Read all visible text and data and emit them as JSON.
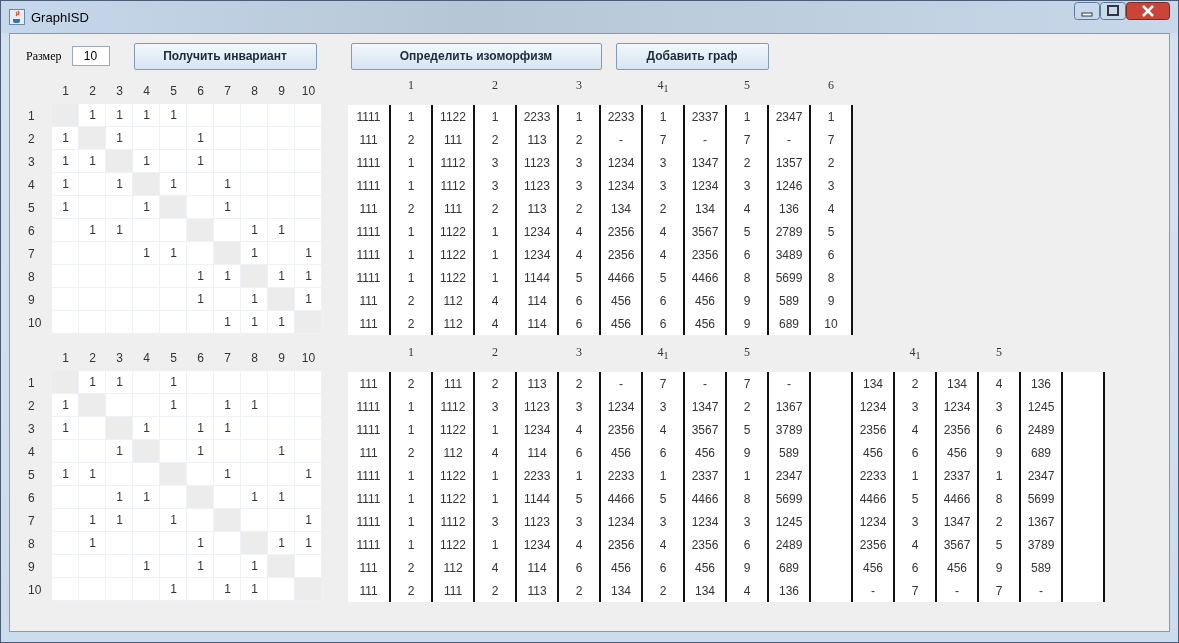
{
  "window": {
    "title": "GraphISD"
  },
  "toolbar": {
    "size_label": "Размер",
    "size_value": "10",
    "buttons": [
      "Получить инвариант",
      "Определить изоморфизм",
      "Добавить граф"
    ]
  },
  "graphs": [
    {
      "matrix": {
        "columns": [
          "1",
          "2",
          "3",
          "4",
          "5",
          "6",
          "7",
          "8",
          "9",
          "10"
        ],
        "rows": [
          {
            "label": "1",
            "cells": [
              null,
              "1",
              "1",
              "1",
              "1",
              null,
              null,
              null,
              null,
              null
            ]
          },
          {
            "label": "2",
            "cells": [
              "1",
              null,
              "1",
              null,
              null,
              "1",
              null,
              null,
              null,
              null
            ]
          },
          {
            "label": "3",
            "cells": [
              "1",
              "1",
              null,
              "1",
              null,
              "1",
              null,
              null,
              null,
              null
            ]
          },
          {
            "label": "4",
            "cells": [
              "1",
              null,
              "1",
              null,
              "1",
              null,
              "1",
              null,
              null,
              null
            ]
          },
          {
            "label": "5",
            "cells": [
              "1",
              null,
              null,
              "1",
              null,
              null,
              "1",
              null,
              null,
              null
            ]
          },
          {
            "label": "6",
            "cells": [
              null,
              "1",
              "1",
              null,
              null,
              null,
              null,
              "1",
              "1",
              null
            ]
          },
          {
            "label": "7",
            "cells": [
              null,
              null,
              null,
              "1",
              "1",
              null,
              null,
              "1",
              null,
              "1"
            ]
          },
          {
            "label": "8",
            "cells": [
              null,
              null,
              null,
              null,
              null,
              "1",
              "1",
              null,
              "1",
              "1"
            ]
          },
          {
            "label": "9",
            "cells": [
              null,
              null,
              null,
              null,
              null,
              "1",
              null,
              "1",
              null,
              "1"
            ]
          },
          {
            "label": "10",
            "cells": [
              null,
              null,
              null,
              null,
              null,
              null,
              "1",
              "1",
              "1",
              null
            ]
          }
        ]
      },
      "invariant": {
        "headers": [
          {
            "kind": "blank"
          },
          {
            "kind": "label",
            "text": "1"
          },
          {
            "kind": "blank"
          },
          {
            "kind": "label",
            "text": "2"
          },
          {
            "kind": "blank"
          },
          {
            "kind": "label",
            "text": "3"
          },
          {
            "kind": "blank"
          },
          {
            "kind": "label",
            "text": "4$_{1}$"
          },
          {
            "kind": "blank"
          },
          {
            "kind": "label",
            "text": "5"
          },
          {
            "kind": "blank"
          },
          {
            "kind": "label",
            "text": "6"
          }
        ],
        "rows": [
          [
            "1111",
            "1",
            "1122",
            "1",
            "2233",
            "1",
            "2233",
            "1",
            "2337",
            "1",
            "2347",
            "1"
          ],
          [
            "111",
            "2",
            "111",
            "2",
            "113",
            "2",
            "-",
            "7",
            "-",
            "7",
            "-",
            "7"
          ],
          [
            "1111",
            "1",
            "1112",
            "3",
            "1123",
            "3",
            "1234",
            "3",
            "1347",
            "2",
            "1357",
            "2"
          ],
          [
            "1111",
            "1",
            "1112",
            "3",
            "1123",
            "3",
            "1234",
            "3",
            "1234",
            "3",
            "1246",
            "3"
          ],
          [
            "111",
            "2",
            "111",
            "2",
            "113",
            "2",
            "134",
            "2",
            "134",
            "4",
            "136",
            "4"
          ],
          [
            "1111",
            "1",
            "1122",
            "1",
            "1234",
            "4",
            "2356",
            "4",
            "3567",
            "5",
            "2789",
            "5"
          ],
          [
            "1111",
            "1",
            "1122",
            "1",
            "1234",
            "4",
            "2356",
            "4",
            "2356",
            "6",
            "3489",
            "6"
          ],
          [
            "1111",
            "1",
            "1122",
            "1",
            "1144",
            "5",
            "4466",
            "5",
            "4466",
            "8",
            "5699",
            "8"
          ],
          [
            "111",
            "2",
            "112",
            "4",
            "114",
            "6",
            "456",
            "6",
            "456",
            "9",
            "589",
            "9"
          ],
          [
            "111",
            "2",
            "112",
            "4",
            "114",
            "6",
            "456",
            "6",
            "456",
            "9",
            "689",
            "10"
          ]
        ]
      }
    },
    {
      "matrix": {
        "columns": [
          "1",
          "2",
          "3",
          "4",
          "5",
          "6",
          "7",
          "8",
          "9",
          "10"
        ],
        "rows": [
          {
            "label": "1",
            "cells": [
              null,
              "1",
              "1",
              null,
              "1",
              null,
              null,
              null,
              null,
              null
            ]
          },
          {
            "label": "2",
            "cells": [
              "1",
              null,
              null,
              null,
              "1",
              null,
              "1",
              "1",
              null,
              null
            ]
          },
          {
            "label": "3",
            "cells": [
              "1",
              null,
              null,
              "1",
              null,
              "1",
              "1",
              null,
              null,
              null
            ]
          },
          {
            "label": "4",
            "cells": [
              null,
              null,
              "1",
              null,
              null,
              "1",
              null,
              null,
              "1",
              null
            ]
          },
          {
            "label": "5",
            "cells": [
              "1",
              "1",
              null,
              null,
              null,
              null,
              "1",
              null,
              null,
              "1"
            ]
          },
          {
            "label": "6",
            "cells": [
              null,
              null,
              "1",
              "1",
              null,
              null,
              null,
              "1",
              "1",
              null
            ]
          },
          {
            "label": "7",
            "cells": [
              null,
              "1",
              "1",
              null,
              "1",
              null,
              null,
              null,
              null,
              "1"
            ]
          },
          {
            "label": "8",
            "cells": [
              null,
              "1",
              null,
              null,
              null,
              "1",
              null,
              null,
              "1",
              "1"
            ]
          },
          {
            "label": "9",
            "cells": [
              null,
              null,
              null,
              "1",
              null,
              "1",
              null,
              "1",
              null,
              null
            ]
          },
          {
            "label": "10",
            "cells": [
              null,
              null,
              null,
              null,
              "1",
              null,
              "1",
              "1",
              null,
              null
            ]
          }
        ]
      },
      "invariant": {
        "headers": [
          {
            "kind": "blank"
          },
          {
            "kind": "label",
            "text": "1"
          },
          {
            "kind": "blank"
          },
          {
            "kind": "label",
            "text": "2"
          },
          {
            "kind": "blank"
          },
          {
            "kind": "label",
            "text": "3"
          },
          {
            "kind": "blank"
          },
          {
            "kind": "label",
            "text": "4$_{1}$"
          },
          {
            "kind": "blank"
          },
          {
            "kind": "label",
            "text": "5"
          },
          {
            "kind": "blank"
          },
          {
            "kind": "blank"
          },
          {
            "kind": "blank"
          },
          {
            "kind": "label",
            "text": "4$_{1}$"
          },
          {
            "kind": "blank"
          },
          {
            "kind": "label",
            "text": "5"
          },
          {
            "kind": "blank"
          },
          {
            "kind": "blank"
          }
        ],
        "rows": [
          [
            "111",
            "2",
            "111",
            "2",
            "113",
            "2",
            "-",
            "7",
            "-",
            "7",
            "-",
            null,
            "134",
            "2",
            "134",
            "4",
            "136",
            null
          ],
          [
            "1111",
            "1",
            "1112",
            "3",
            "1123",
            "3",
            "1234",
            "3",
            "1347",
            "2",
            "1367",
            null,
            "1234",
            "3",
            "1234",
            "3",
            "1245",
            null
          ],
          [
            "1111",
            "1",
            "1122",
            "1",
            "1234",
            "4",
            "2356",
            "4",
            "3567",
            "5",
            "3789",
            null,
            "2356",
            "4",
            "2356",
            "6",
            "2489",
            null
          ],
          [
            "111",
            "2",
            "112",
            "4",
            "114",
            "6",
            "456",
            "6",
            "456",
            "9",
            "589",
            null,
            "456",
            "6",
            "456",
            "9",
            "689",
            null
          ],
          [
            "1111",
            "1",
            "1122",
            "1",
            "2233",
            "1",
            "2233",
            "1",
            "2337",
            "1",
            "2347",
            null,
            "2233",
            "1",
            "2337",
            "1",
            "2347",
            null
          ],
          [
            "1111",
            "1",
            "1122",
            "1",
            "1144",
            "5",
            "4466",
            "5",
            "4466",
            "8",
            "5699",
            null,
            "4466",
            "5",
            "4466",
            "8",
            "5699",
            null
          ],
          [
            "1111",
            "1",
            "1112",
            "3",
            "1123",
            "3",
            "1234",
            "3",
            "1234",
            "3",
            "1245",
            null,
            "1234",
            "3",
            "1347",
            "2",
            "1367",
            null
          ],
          [
            "1111",
            "1",
            "1122",
            "1",
            "1234",
            "4",
            "2356",
            "4",
            "2356",
            "6",
            "2489",
            null,
            "2356",
            "4",
            "3567",
            "5",
            "3789",
            null
          ],
          [
            "111",
            "2",
            "112",
            "4",
            "114",
            "6",
            "456",
            "6",
            "456",
            "9",
            "689",
            null,
            "456",
            "6",
            "456",
            "9",
            "589",
            null
          ],
          [
            "111",
            "2",
            "111",
            "2",
            "113",
            "2",
            "134",
            "2",
            "134",
            "4",
            "136",
            null,
            "-",
            "7",
            "-",
            "7",
            "-",
            null
          ]
        ]
      }
    }
  ]
}
